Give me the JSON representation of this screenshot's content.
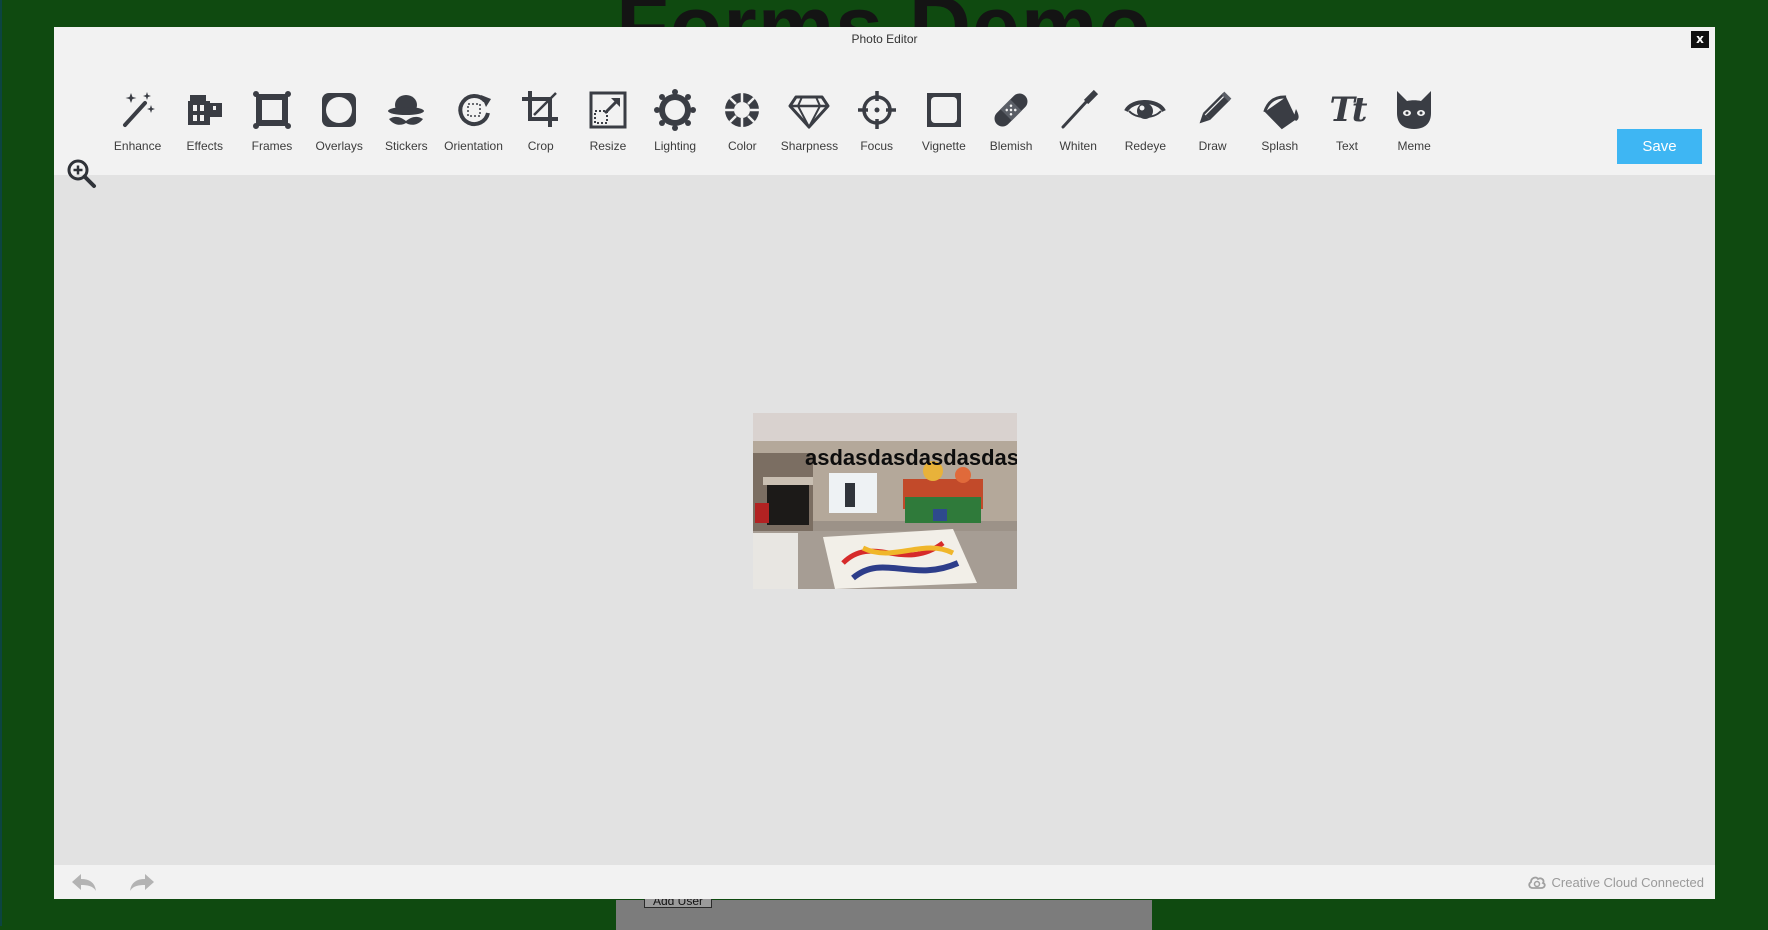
{
  "background_page": {
    "title": "Forms Demo",
    "add_user_button": "Add User"
  },
  "editor": {
    "title": "Photo Editor",
    "close_label": "x",
    "save_label": "Save",
    "tools": [
      {
        "label": "Enhance",
        "icon": "magic-wand-icon"
      },
      {
        "label": "Effects",
        "icon": "film-icon"
      },
      {
        "label": "Frames",
        "icon": "frame-icon"
      },
      {
        "label": "Overlays",
        "icon": "overlay-icon"
      },
      {
        "label": "Stickers",
        "icon": "hat-mustache-icon"
      },
      {
        "label": "Orientation",
        "icon": "rotate-icon"
      },
      {
        "label": "Crop",
        "icon": "crop-icon"
      },
      {
        "label": "Resize",
        "icon": "resize-icon"
      },
      {
        "label": "Lighting",
        "icon": "sun-icon"
      },
      {
        "label": "Color",
        "icon": "color-wheel-icon"
      },
      {
        "label": "Sharpness",
        "icon": "diamond-icon"
      },
      {
        "label": "Focus",
        "icon": "crosshair-icon"
      },
      {
        "label": "Vignette",
        "icon": "vignette-icon"
      },
      {
        "label": "Blemish",
        "icon": "bandage-icon"
      },
      {
        "label": "Whiten",
        "icon": "brush-icon"
      },
      {
        "label": "Redeye",
        "icon": "eye-icon"
      },
      {
        "label": "Draw",
        "icon": "pencil-icon"
      },
      {
        "label": "Splash",
        "icon": "paint-bucket-icon"
      },
      {
        "label": "Text",
        "icon": "text-icon"
      },
      {
        "label": "Meme",
        "icon": "cat-face-icon"
      }
    ],
    "text_icon_glyph": "Tt",
    "photo": {
      "overlay_text": "asdasdasdasdasdasd"
    },
    "footer": {
      "cc_status": "Creative Cloud Connected"
    }
  },
  "colors": {
    "page_background": "#0f4a10",
    "save_button": "#3eb6f3",
    "icon": "#3a3d44"
  }
}
